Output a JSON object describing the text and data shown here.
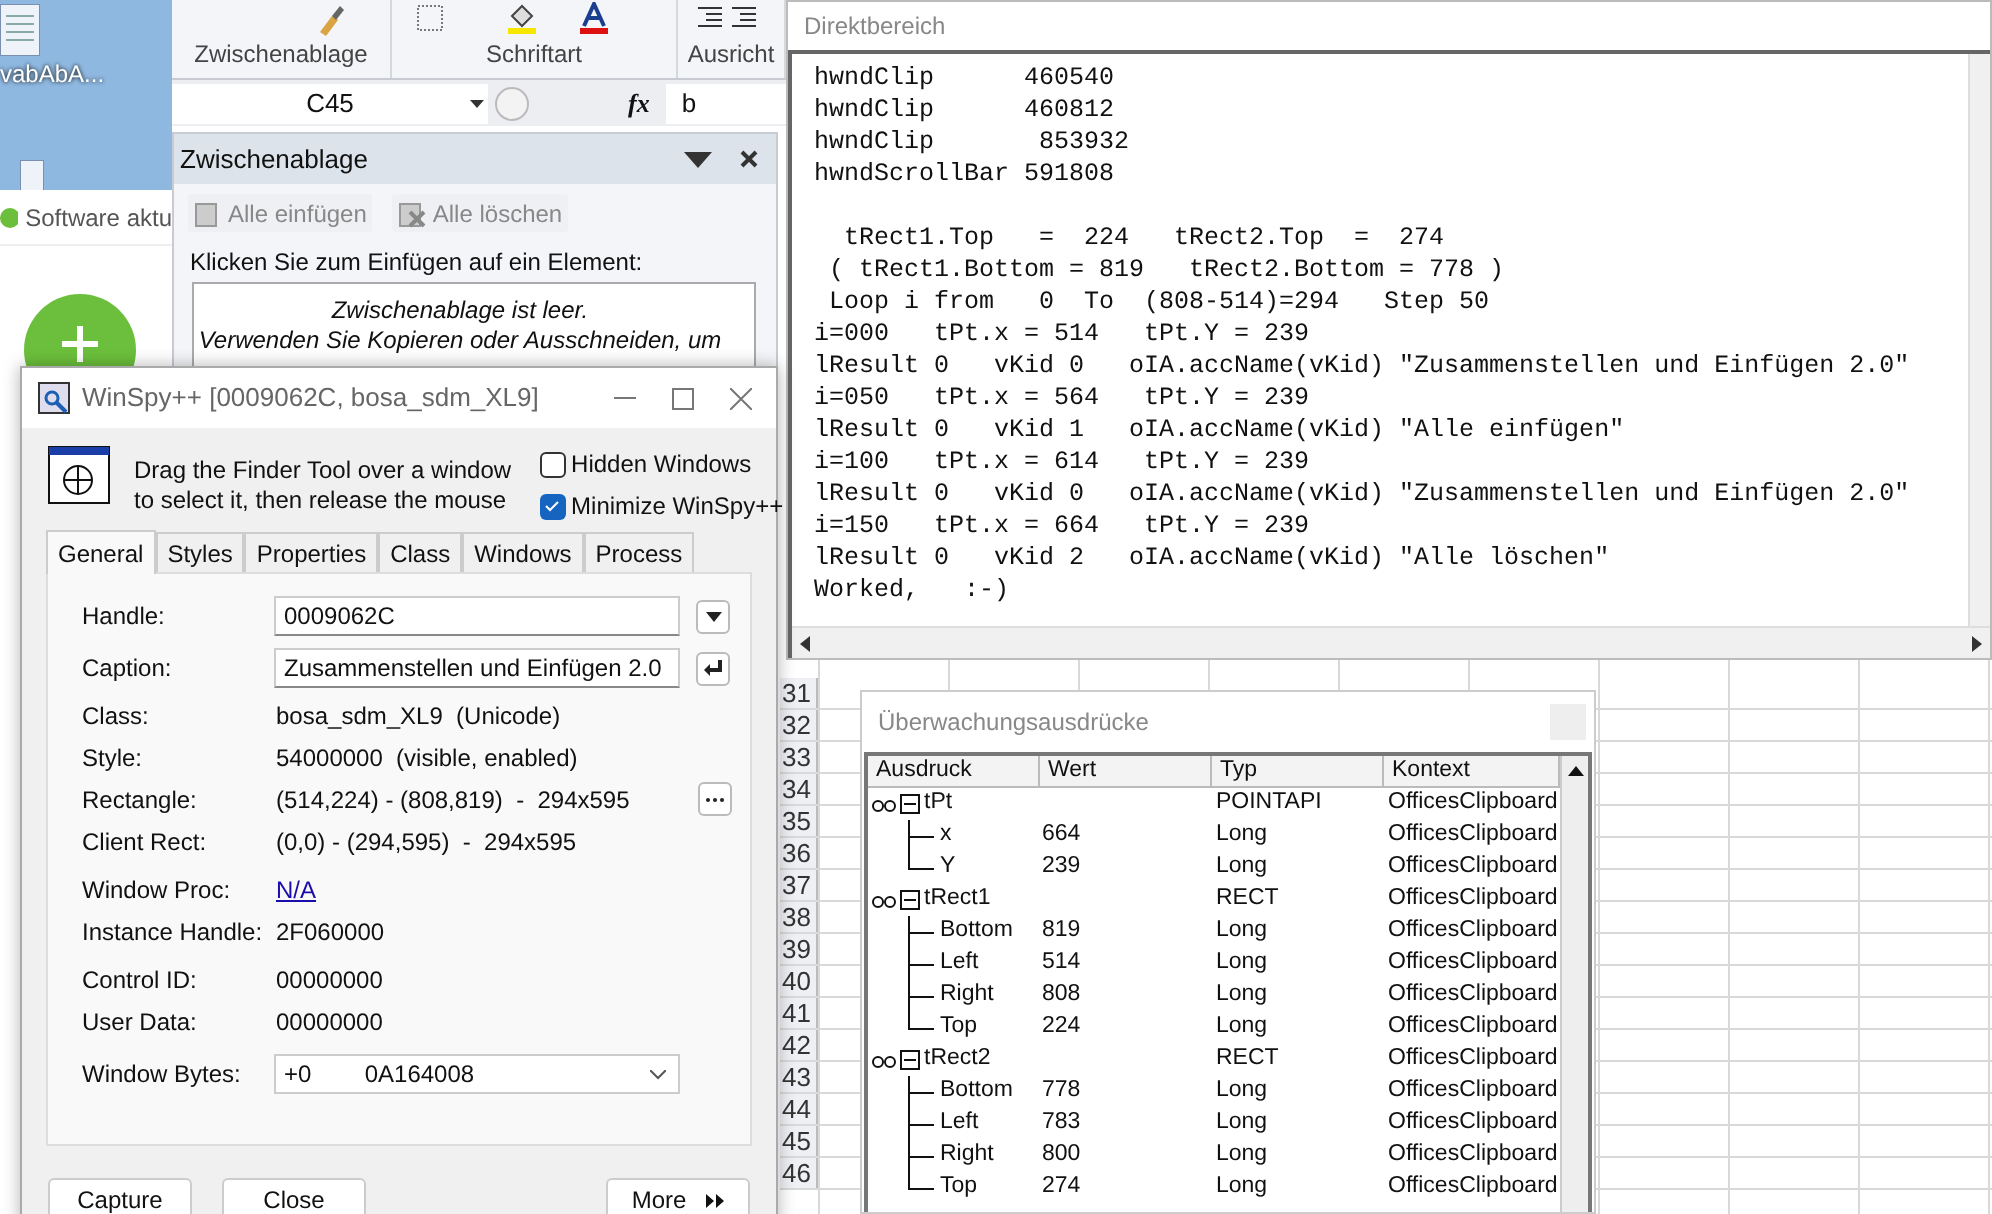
{
  "desktop": {
    "icon_label": "vabAbA...",
    "popup_title": "Software aktu"
  },
  "ribbon": {
    "groups": [
      {
        "label": "Zwischenablage"
      },
      {
        "label": "Schriftart"
      },
      {
        "label": "Ausricht"
      }
    ]
  },
  "formula_bar": {
    "name_box": "C45",
    "fx": "fx",
    "value": "b"
  },
  "clipboard_pane": {
    "title": "Zwischenablage",
    "buttons": [
      {
        "label": "Alle einfügen",
        "kind": "paste",
        "disabled": true
      },
      {
        "label": "Alle löschen",
        "kind": "clear",
        "disabled": true
      }
    ],
    "instruction": "Klicken Sie zum Einfügen auf ein Element:",
    "empty_message": [
      "Zwischenablage ist leer.",
      "Verwenden Sie Kopieren oder Ausschneiden, um"
    ]
  },
  "immediate": {
    "title": "Direktbereich",
    "blocks": [
      [
        "hwndClip      460540",
        "hwndClip      460812",
        "hwndClip       853932",
        "hwndScrollBar 591808"
      ],
      [
        "  tRect1.Top   =  224   tRect2.Top  =  274",
        " ( tRect1.Bottom = 819   tRect2.Bottom = 778 )",
        " Loop i from   0  To  (808-514)=294   Step 50",
        "i=000   tPt.x = 514   tPt.Y = 239",
        "lResult 0   vKid 0   oIA.accName(vKid) \"Zusammenstellen und Einfügen 2.0\"",
        "i=050   tPt.x = 564   tPt.Y = 239",
        "lResult 0   vKid 1   oIA.accName(vKid) \"Alle einfügen\"",
        "i=100   tPt.x = 614   tPt.Y = 239",
        "lResult 0   vKid 0   oIA.accName(vKid) \"Zusammenstellen und Einfügen 2.0\"",
        "i=150   tPt.x = 664   tPt.Y = 239",
        "lResult 0   vKid 2   oIA.accName(vKid) \"Alle löschen\"",
        "Worked,   :-)"
      ]
    ]
  },
  "sheet": {
    "row_numbers": [
      "31",
      "32",
      "33",
      "34",
      "35",
      "36",
      "37",
      "38",
      "39",
      "40",
      "41",
      "42",
      "43",
      "44",
      "45",
      "46"
    ]
  },
  "watch": {
    "title": "Überwachungsausdrücke",
    "columns": [
      "Ausdruck",
      "Wert",
      "Typ",
      "Kontext"
    ],
    "items": [
      {
        "expression": "tPt",
        "type": "POINTAPI",
        "context": "OfficesClipboard",
        "expanded": true,
        "children": [
          {
            "expression": "x",
            "value": "664",
            "type": "Long",
            "context": "OfficesClipboard"
          },
          {
            "expression": "Y",
            "value": "239",
            "type": "Long",
            "context": "OfficesClipboard"
          }
        ]
      },
      {
        "expression": "tRect1",
        "type": "RECT",
        "context": "OfficesClipboard",
        "expanded": true,
        "children": [
          {
            "expression": "Bottom",
            "value": "819",
            "type": "Long",
            "context": "OfficesClipboard"
          },
          {
            "expression": "Left",
            "value": "514",
            "type": "Long",
            "context": "OfficesClipboard"
          },
          {
            "expression": "Right",
            "value": "808",
            "type": "Long",
            "context": "OfficesClipboard"
          },
          {
            "expression": "Top",
            "value": "224",
            "type": "Long",
            "context": "OfficesClipboard"
          }
        ]
      },
      {
        "expression": "tRect2",
        "type": "RECT",
        "context": "OfficesClipboard",
        "expanded": true,
        "children": [
          {
            "expression": "Bottom",
            "value": "778",
            "type": "Long",
            "context": "OfficesClipboard"
          },
          {
            "expression": "Left",
            "value": "783",
            "type": "Long",
            "context": "OfficesClipboard"
          },
          {
            "expression": "Right",
            "value": "800",
            "type": "Long",
            "context": "OfficesClipboard"
          },
          {
            "expression": "Top",
            "value": "274",
            "type": "Long",
            "context": "OfficesClipboard"
          }
        ]
      }
    ]
  },
  "winspy": {
    "title": "WinSpy++ [0009062C, bosa_sdm_XL9]",
    "finder_text": [
      "Drag the Finder Tool over a window",
      "to select it, then release the mouse"
    ],
    "options": [
      {
        "label": "Hidden Windows",
        "checked": false
      },
      {
        "label": "Minimize WinSpy++",
        "checked": true
      }
    ],
    "tabs": [
      {
        "label": "General",
        "selected": true
      },
      {
        "label": "Styles",
        "selected": false
      },
      {
        "label": "Properties",
        "selected": false
      },
      {
        "label": "Class",
        "selected": false
      },
      {
        "label": "Windows",
        "selected": false
      },
      {
        "label": "Process",
        "selected": false
      }
    ],
    "fields": [
      {
        "label": "Handle:",
        "value": "0009062C",
        "kind": "input",
        "side_button": {
          "kind": "dropdown"
        }
      },
      {
        "label": "Caption:",
        "value": "Zusammenstellen und Einfügen 2.0",
        "kind": "input",
        "side_button": {
          "kind": "enter"
        }
      },
      {
        "label": "Class:",
        "value": "bosa_sdm_XL9  (Unicode)",
        "kind": "text"
      },
      {
        "label": "Style:",
        "value": "54000000  (visible, enabled)",
        "kind": "text"
      },
      {
        "label": "Rectangle:",
        "value": "(514,224) - (808,819)  -  294x595",
        "kind": "text",
        "side_button": {
          "kind": "more"
        }
      },
      {
        "label": "Client Rect:",
        "value": "(0,0) - (294,595)  -  294x595",
        "kind": "text"
      },
      {
        "label": "Window Proc:",
        "value": "N/A",
        "kind": "link"
      },
      {
        "label": "Instance Handle:",
        "value": "2F060000",
        "kind": "text"
      },
      {
        "label": "Control ID:",
        "value": "00000000",
        "kind": "text"
      },
      {
        "label": "User Data:",
        "value": "00000000",
        "kind": "text"
      },
      {
        "label": "Window Bytes:",
        "value": "+0        0A164008",
        "kind": "select"
      }
    ],
    "buttons": [
      {
        "label": "Capture",
        "kind": "plain"
      },
      {
        "label": "Close",
        "kind": "plain"
      },
      {
        "label": "More",
        "kind": "more"
      }
    ]
  }
}
